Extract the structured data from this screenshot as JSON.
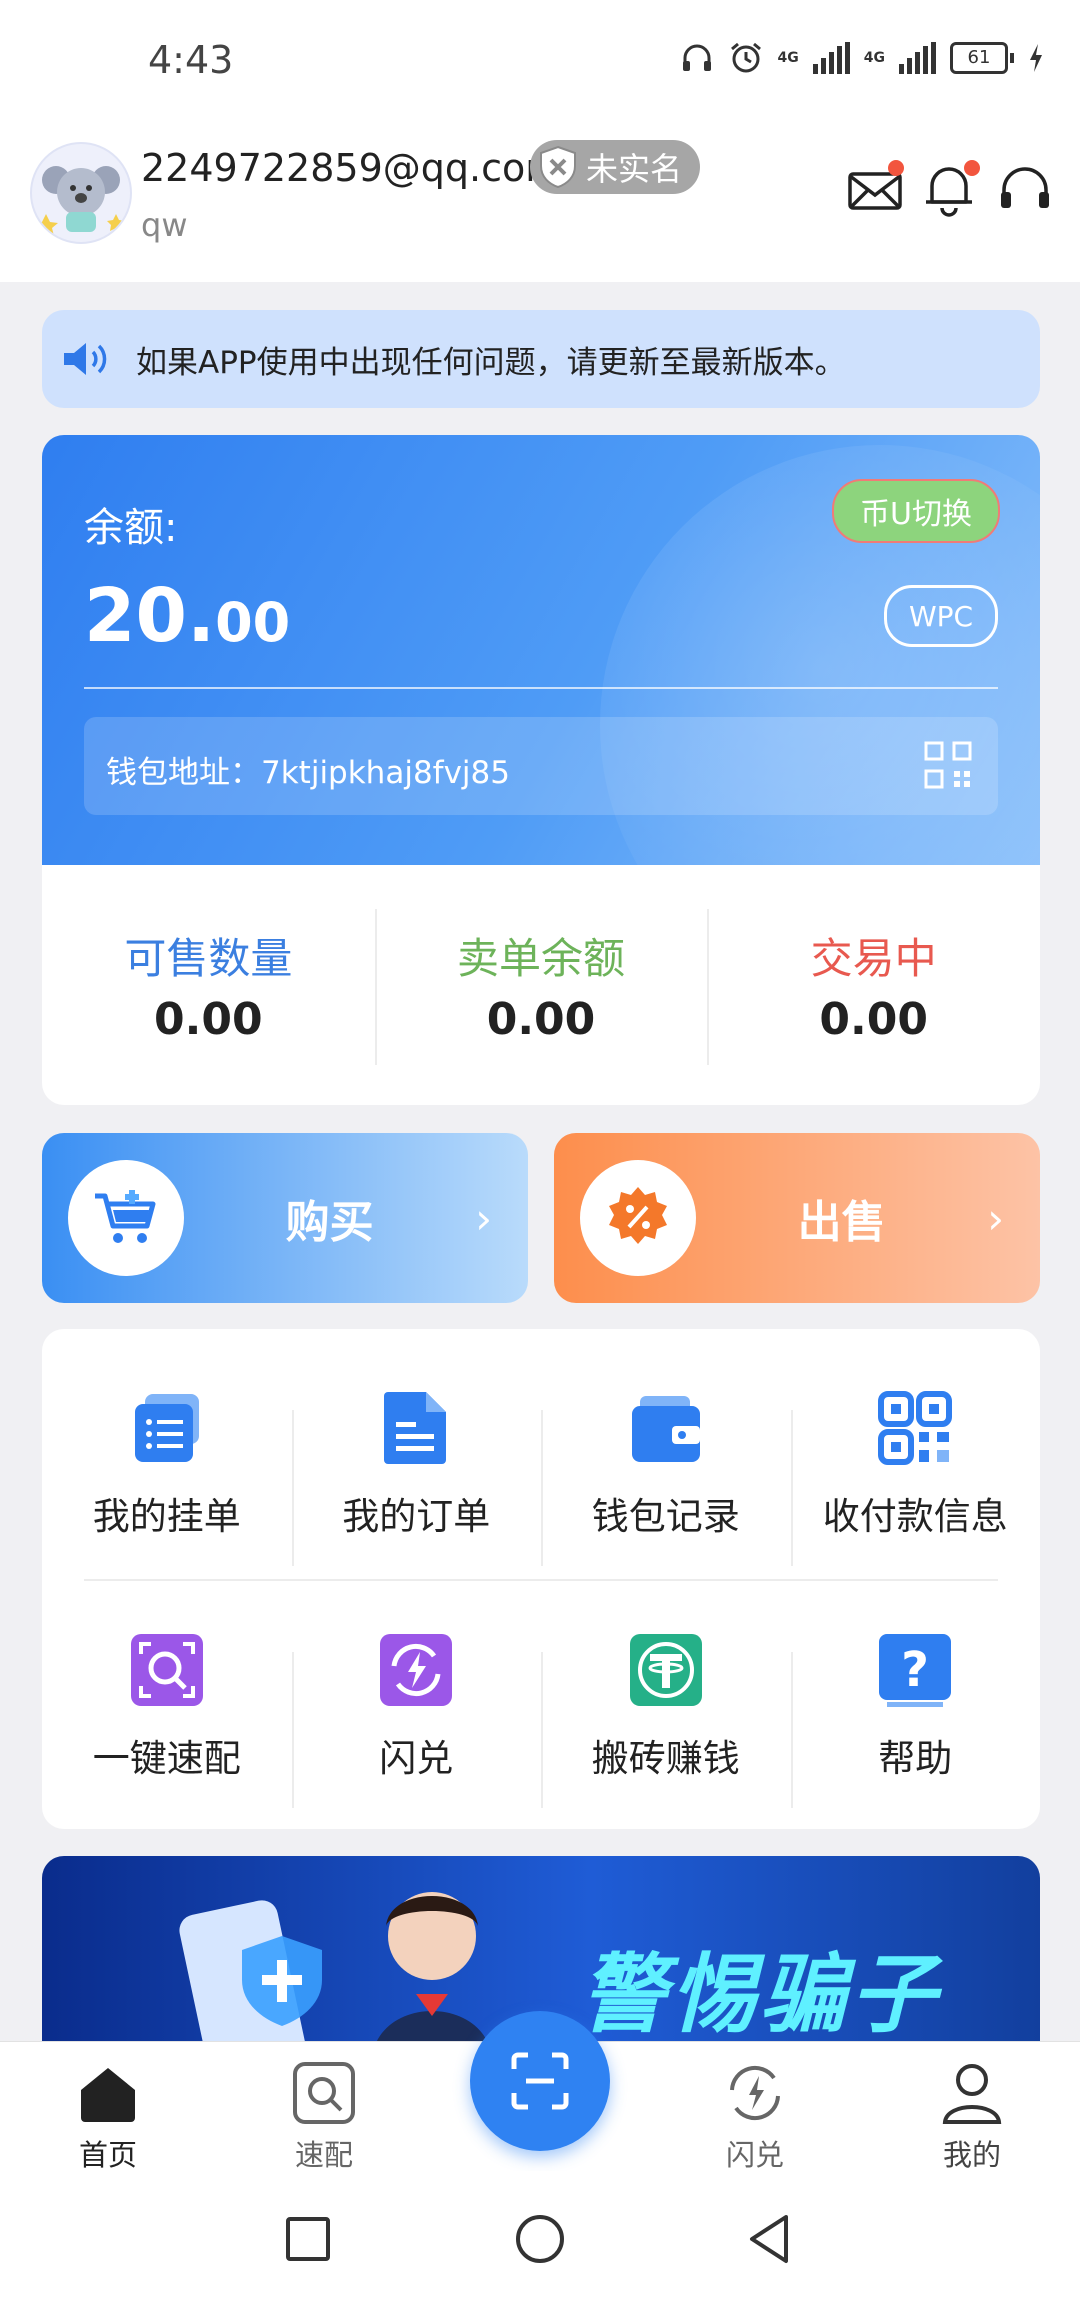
{
  "status_bar": {
    "time": "4:43",
    "network1": "4G",
    "network2": "4G",
    "battery": "61"
  },
  "header": {
    "email": "2249722859@qq.com",
    "username": "qw",
    "realname_status": "未实名"
  },
  "notice": {
    "text": "如果APP使用中出现任何问题，请更新至最新版本。"
  },
  "balance_card": {
    "label": "余额:",
    "value_int": "20.",
    "value_dec": "00",
    "switch_label": "币U切换",
    "currency_label": "WPC",
    "wallet_address_text": "钱包地址：7ktjipkhaj8fvj85"
  },
  "stats": [
    {
      "label": "可售数量",
      "value": "0.00",
      "color": "#3b7fe0"
    },
    {
      "label": "卖单余额",
      "value": "0.00",
      "color": "#6db35a"
    },
    {
      "label": "交易中",
      "value": "0.00",
      "color": "#e8594f"
    }
  ],
  "actions": {
    "buy_label": "购买",
    "sell_label": "出售",
    "arrow": "›"
  },
  "menu": [
    {
      "label": "我的挂单",
      "icon": "list-icon"
    },
    {
      "label": "我的订单",
      "icon": "order-icon"
    },
    {
      "label": "钱包记录",
      "icon": "wallet-icon"
    },
    {
      "label": "收付款信息",
      "icon": "qr-payment-icon"
    },
    {
      "label": "一键速配",
      "icon": "quick-match-icon"
    },
    {
      "label": "闪兑",
      "icon": "flash-exchange-icon"
    },
    {
      "label": "搬砖赚钱",
      "icon": "tether-icon"
    },
    {
      "label": "帮助",
      "icon": "help-icon"
    }
  ],
  "banner": {
    "text": "警惕骗子"
  },
  "bottom_nav": {
    "items": [
      {
        "label": "首页",
        "icon": "home-icon",
        "active": true
      },
      {
        "label": "速配",
        "icon": "match-icon",
        "active": false
      },
      {
        "label": "闪兑",
        "icon": "exchange-icon",
        "active": false
      },
      {
        "label": "我的",
        "icon": "profile-icon",
        "active": false
      }
    ]
  },
  "colors": {
    "primary": "#2f82f2",
    "buy_gradient_start": "#3a8ff3",
    "sell_gradient_start": "#fd8e4c",
    "notice_bg": "#cfe1fd",
    "badge_red": "#f2553e"
  }
}
